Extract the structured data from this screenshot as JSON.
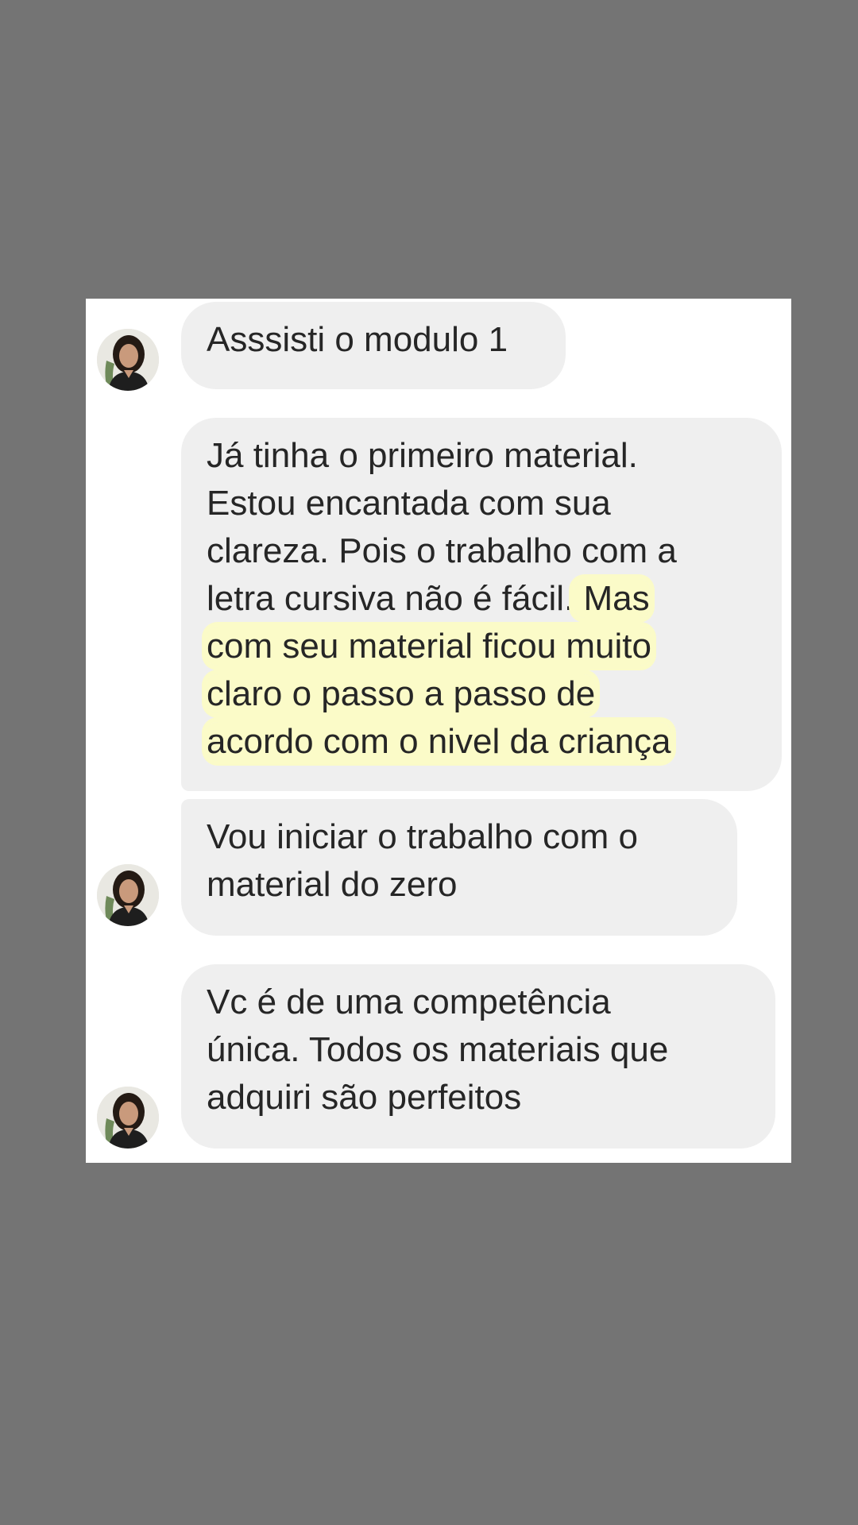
{
  "colors": {
    "page_background": "#747474",
    "card_background": "#ffffff",
    "bubble_background": "#efefef",
    "text": "#262626",
    "highlight": "#fbfbc8"
  },
  "messages": [
    {
      "lines": [
        "Asssisti o modulo 1"
      ],
      "avatar": "contact-avatar"
    },
    {
      "lines_plain": [
        "Já tinha o primeiro material.",
        "Estou encantada com sua",
        "clareza. Pois o trabalho com a",
        "letra cursiva não é fácil."
      ],
      "line4_highlight": " Mas",
      "lines_highlighted": [
        "com seu material ficou muito",
        "claro o passo a passo de",
        "acordo com o nivel da criança"
      ]
    },
    {
      "lines": [
        "Vou iniciar o trabalho com o",
        "material do zero"
      ],
      "avatar": "contact-avatar"
    },
    {
      "lines": [
        "Vc é de uma competência",
        "única. Todos os materiais que",
        "adquiri são perfeitos"
      ],
      "avatar": "contact-avatar"
    }
  ]
}
